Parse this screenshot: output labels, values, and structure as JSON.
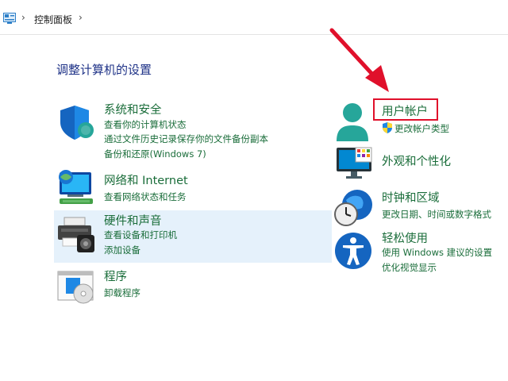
{
  "breadcrumb": {
    "current": "控制面板",
    "separator": "›"
  },
  "page_title": "调整计算机的设置",
  "left_categories": [
    {
      "title": "系统和安全",
      "icon": "shield-icon",
      "links": [
        "查看你的计算机状态",
        "通过文件历史记录保存你的文件备份副本",
        "备份和还原(Windows 7)"
      ]
    },
    {
      "title": "网络和 Internet",
      "icon": "network-globe-icon",
      "links": [
        "查看网络状态和任务"
      ]
    },
    {
      "title": "硬件和声音",
      "icon": "printer-speaker-icon",
      "links": [
        "查看设备和打印机",
        "添加设备"
      ]
    },
    {
      "title": "程序",
      "icon": "programs-disc-icon",
      "links": [
        "卸载程序"
      ]
    }
  ],
  "right_categories": [
    {
      "title": "用户帐户",
      "icon": "user-account-icon",
      "links": [
        "更改帐户类型"
      ]
    },
    {
      "title": "外观和个性化",
      "icon": "monitor-palette-icon",
      "links": []
    },
    {
      "title": "时钟和区域",
      "icon": "clock-globe-icon",
      "links": [
        "更改日期、时间或数字格式"
      ]
    },
    {
      "title": "轻松使用",
      "icon": "accessibility-icon",
      "links": [
        "使用 Windows 建议的设置",
        "优化视觉显示"
      ]
    }
  ],
  "colors": {
    "link_green": "#1a6d3a",
    "title_blue": "#1e3287",
    "highlight_bg": "#e5f1fb",
    "annotation_red": "#e0102b"
  }
}
